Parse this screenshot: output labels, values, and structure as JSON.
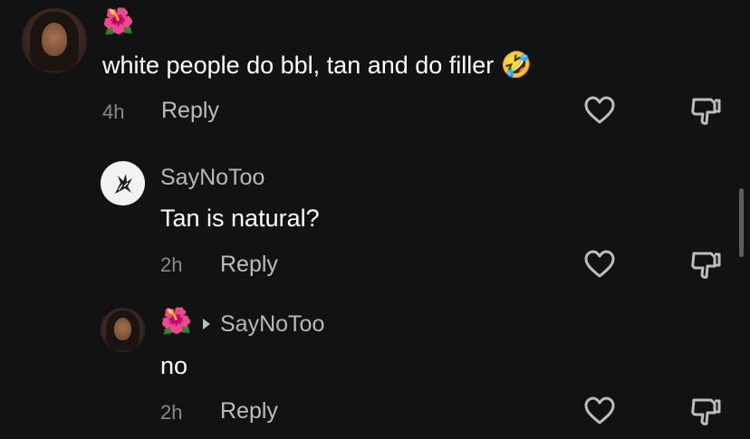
{
  "comments": [
    {
      "author_emoji": "🌺",
      "text": "white people do bbl, tan and do filler",
      "text_emoji": "🤣",
      "time": "4h",
      "reply_label": "Reply"
    },
    {
      "username": "SayNoToo",
      "text": "Tan is natural?",
      "time": "2h",
      "reply_label": "Reply"
    },
    {
      "author_emoji": "🌺",
      "reply_to": "SayNoToo",
      "text": "no",
      "time": "2h",
      "reply_label": "Reply"
    }
  ],
  "icons": {
    "like": "heart-icon",
    "dislike": "thumbs-down-icon",
    "reply_arrow": "triangle-right-icon"
  },
  "colors": {
    "background": "#121212",
    "primary_text": "#ffffff",
    "secondary_text": "#8a8a8a"
  }
}
